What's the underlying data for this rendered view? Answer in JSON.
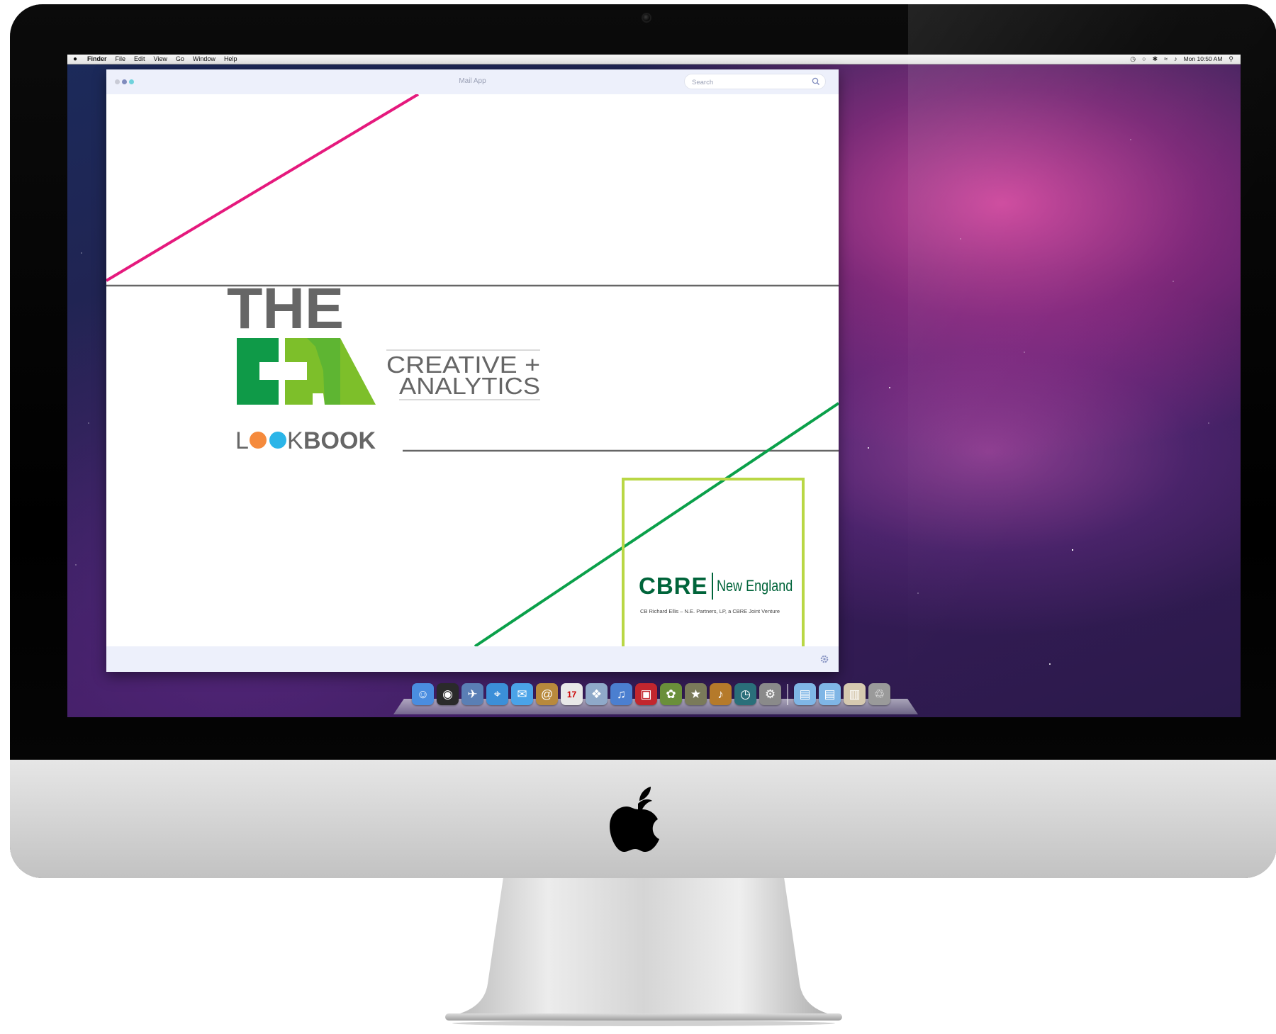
{
  "menubar": {
    "apple": "",
    "items": [
      "Finder",
      "File",
      "Edit",
      "View",
      "Go",
      "Window",
      "Help"
    ],
    "clock": "Mon 10:50 AM"
  },
  "window": {
    "title": "Mail App",
    "search_placeholder": "Search"
  },
  "lookbook": {
    "the": "THE",
    "ca_glyphs": "C A",
    "creative": "CREATIVE +",
    "analytics": "ANALYTICS",
    "look_l": "L",
    "look_k": "K",
    "book": "BOOK"
  },
  "cbre": {
    "name": "CBRE",
    "region": "New England",
    "tagline": "CB Richard Ellis – N.E. Partners, LP, a CBRE Joint Venture"
  },
  "colors": {
    "magenta_line": "#e5197d",
    "green_line": "#0aa04a",
    "dark_gray": "#666666",
    "green_dark": "#0f9a48",
    "green_light": "#7dbf2a",
    "orange_dot": "#f58a3c",
    "blue_dot": "#2bb5e8",
    "cbre_green": "#00643a",
    "cbre_box": "#b9d745"
  },
  "dock": {
    "apps": [
      {
        "icon": "finder-icon",
        "glyph": "☺",
        "color": "#4a8de0"
      },
      {
        "icon": "dashboard-icon",
        "glyph": "◉",
        "color": "#2a2a2a"
      },
      {
        "icon": "mail-icon",
        "glyph": "✈",
        "color": "#5a7fb5"
      },
      {
        "icon": "safari-icon",
        "glyph": "⌖",
        "color": "#3b8fd8"
      },
      {
        "icon": "ichat-icon",
        "glyph": "✉",
        "color": "#4aa3e8"
      },
      {
        "icon": "address-book-icon",
        "glyph": "@",
        "color": "#b8893c"
      },
      {
        "icon": "ical-icon",
        "glyph": "17",
        "color": "#e8e8e8"
      },
      {
        "icon": "preview-icon",
        "glyph": "❖",
        "color": "#8fa9c9"
      },
      {
        "icon": "itunes-icon",
        "glyph": "♫",
        "color": "#4b7fd0"
      },
      {
        "icon": "photo-booth-icon",
        "glyph": "▣",
        "color": "#c2262e"
      },
      {
        "icon": "iphoto-icon",
        "glyph": "✿",
        "color": "#6a8f3a"
      },
      {
        "icon": "imovie-icon",
        "glyph": "★",
        "color": "#7a7a5a"
      },
      {
        "icon": "garageband-icon",
        "glyph": "♪",
        "color": "#b57a2a"
      },
      {
        "icon": "time-machine-icon",
        "glyph": "◷",
        "color": "#2a6f7a"
      },
      {
        "icon": "system-preferences-icon",
        "glyph": "⚙",
        "color": "#8a8a8a"
      },
      {
        "icon": "applications-folder-icon",
        "glyph": "▤",
        "color": "#7fb6e6"
      },
      {
        "icon": "documents-folder-icon",
        "glyph": "▤",
        "color": "#7fb6e6"
      },
      {
        "icon": "downloads-stack-icon",
        "glyph": "▥",
        "color": "#d6c9b0"
      },
      {
        "icon": "trash-icon",
        "glyph": "♲",
        "color": "#9a9a9a"
      }
    ]
  }
}
